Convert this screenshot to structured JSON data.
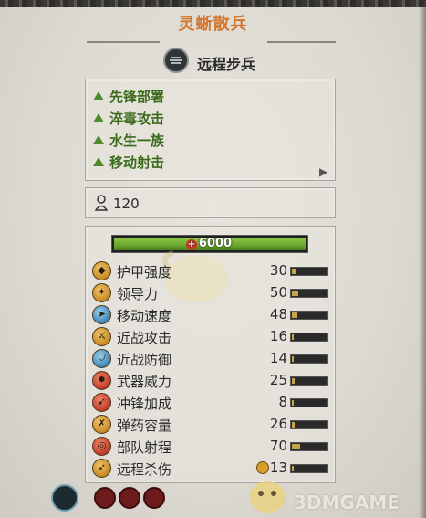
{
  "unit": {
    "name": "灵蜥散兵",
    "class_label": "远程步兵"
  },
  "attributes": [
    "先锋部署",
    "淬毒攻击",
    "水生一族",
    "移动射击"
  ],
  "men": "120",
  "health": {
    "text": "6000",
    "fill_fraction": 1.0
  },
  "stats": [
    {
      "label": "护甲强度",
      "value": "30",
      "icon": "armor-icon",
      "bar": 0.3
    },
    {
      "label": "领导力",
      "value": "50",
      "icon": "leadership-icon",
      "bar": 0.5
    },
    {
      "label": "移动速度",
      "value": "48",
      "icon": "speed-icon",
      "bar": 0.48
    },
    {
      "label": "近战攻击",
      "value": "16",
      "icon": "melee-attack-icon",
      "bar": 0.16
    },
    {
      "label": "近战防御",
      "value": "14",
      "icon": "melee-defence-icon",
      "bar": 0.14
    },
    {
      "label": "武器威力",
      "value": "25",
      "icon": "weapon-strength-icon",
      "bar": 0.25
    },
    {
      "label": "冲锋加成",
      "value": "8",
      "icon": "charge-bonus-icon",
      "bar": 0.08
    },
    {
      "label": "弹药容量",
      "value": "26",
      "icon": "ammunition-icon",
      "bar": 0.26
    },
    {
      "label": "部队射程",
      "value": "70",
      "icon": "range-icon",
      "bar": 0.7
    },
    {
      "label": "远程杀伤",
      "value": "13",
      "icon": "missile-damage-icon",
      "bar": 0.13
    }
  ],
  "watermark": "3DMGAME",
  "colors": {
    "title": "#d3762b",
    "attribute_text": "#3b6b1a",
    "health_fill": "#6aa82e"
  }
}
